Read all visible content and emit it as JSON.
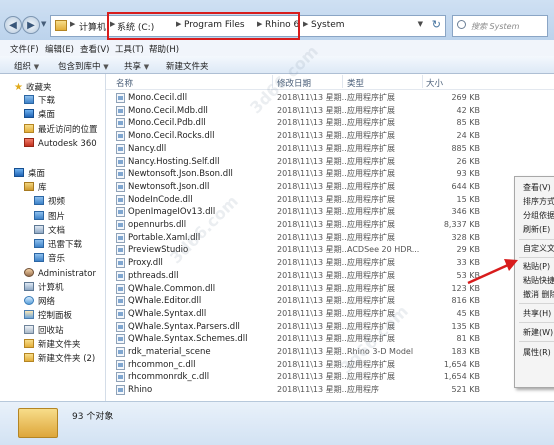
{
  "address": {
    "crumbs": [
      "计算机",
      "系统 (C:)",
      "Program Files",
      "Rhino 6",
      "System"
    ],
    "search_placeholder": "搜索 System"
  },
  "menu": [
    "文件(F)",
    "编辑(E)",
    "查看(V)",
    "工具(T)",
    "帮助(H)"
  ],
  "toolbar": {
    "organize": "组织",
    "include": "包含到库中",
    "share": "共享",
    "new_folder": "新建文件夹"
  },
  "sidebar": {
    "favorites": "收藏夹",
    "downloads": "下载",
    "desktop_fav": "桌面",
    "recent": "最近访问的位置",
    "autodesk": "Autodesk 360",
    "desktop": "桌面",
    "libraries": "库",
    "videos": "视频",
    "pictures": "图片",
    "documents": "文档",
    "thunder": "迅雷下载",
    "music": "音乐",
    "admin": "Administrator",
    "computer": "计算机",
    "network": "网络",
    "control": "控制面板",
    "recycle": "回收站",
    "newfolder": "新建文件夹",
    "newfolder2": "新建文件夹 (2)"
  },
  "headers": {
    "name": "名称",
    "date": "修改日期",
    "type": "类型",
    "size": "大小"
  },
  "files": [
    {
      "name": "Mono.Cecil.dll",
      "date": "2018\\11\\13 星期...",
      "type": "应用程序扩展",
      "size": "269 KB"
    },
    {
      "name": "Mono.Cecil.Mdb.dll",
      "date": "2018\\11\\13 星期...",
      "type": "应用程序扩展",
      "size": "42 KB"
    },
    {
      "name": "Mono.Cecil.Pdb.dll",
      "date": "2018\\11\\13 星期...",
      "type": "应用程序扩展",
      "size": "85 KB"
    },
    {
      "name": "Mono.Cecil.Rocks.dll",
      "date": "2018\\11\\13 星期...",
      "type": "应用程序扩展",
      "size": "24 KB"
    },
    {
      "name": "Nancy.dll",
      "date": "2018\\11\\13 星期...",
      "type": "应用程序扩展",
      "size": "885 KB"
    },
    {
      "name": "Nancy.Hosting.Self.dll",
      "date": "2018\\11\\13 星期...",
      "type": "应用程序扩展",
      "size": "26 KB"
    },
    {
      "name": "Newtonsoft.Json.Bson.dll",
      "date": "2018\\11\\13 星期...",
      "type": "应用程序扩展",
      "size": "93 KB"
    },
    {
      "name": "Newtonsoft.Json.dll",
      "date": "2018\\11\\13 星期...",
      "type": "应用程序扩展",
      "size": "644 KB"
    },
    {
      "name": "NodeInCode.dll",
      "date": "2018\\11\\13 星期...",
      "type": "应用程序扩展",
      "size": "15 KB"
    },
    {
      "name": "OpenImageIOv13.dll",
      "date": "2018\\11\\13 星期...",
      "type": "应用程序扩展",
      "size": "346 KB"
    },
    {
      "name": "opennurbs.dll",
      "date": "2018\\11\\13 星期...",
      "type": "应用程序扩展",
      "size": "8,337 KB"
    },
    {
      "name": "Portable.Xaml.dll",
      "date": "2018\\11\\13 星期...",
      "type": "应用程序扩展",
      "size": "328 KB"
    },
    {
      "name": "PreviewStudio",
      "date": "2018\\11\\13 星期...",
      "type": "ACDSee 20 HDR...",
      "size": "29 KB"
    },
    {
      "name": "Proxy.dll",
      "date": "2018\\11\\13 星期...",
      "type": "应用程序扩展",
      "size": "33 KB"
    },
    {
      "name": "pthreads.dll",
      "date": "2018\\11\\13 星期...",
      "type": "应用程序扩展",
      "size": "53 KB"
    },
    {
      "name": "QWhale.Common.dll",
      "date": "2018\\11\\13 星期...",
      "type": "应用程序扩展",
      "size": "123 KB"
    },
    {
      "name": "QWhale.Editor.dll",
      "date": "2018\\11\\13 星期...",
      "type": "应用程序扩展",
      "size": "816 KB"
    },
    {
      "name": "QWhale.Syntax.dll",
      "date": "2018\\11\\13 星期...",
      "type": "应用程序扩展",
      "size": "45 KB"
    },
    {
      "name": "QWhale.Syntax.Parsers.dll",
      "date": "2018\\11\\13 星期...",
      "type": "应用程序扩展",
      "size": "135 KB"
    },
    {
      "name": "QWhale.Syntax.Schemes.dll",
      "date": "2018\\11\\13 星期...",
      "type": "应用程序扩展",
      "size": "81 KB"
    },
    {
      "name": "rdk_material_scene",
      "date": "2018\\11\\13 星期...",
      "type": "Rhino 3-D Model",
      "size": "183 KB"
    },
    {
      "name": "rhcommon_c.dll",
      "date": "2018\\11\\13 星期...",
      "type": "应用程序扩展",
      "size": "1,654 KB"
    },
    {
      "name": "rhcommonrdk_c.dll",
      "date": "2018\\11\\13 星期...",
      "type": "应用程序扩展",
      "size": "1,654 KB"
    },
    {
      "name": "Rhino",
      "date": "2018\\11\\13 星期...",
      "type": "应用程序",
      "size": "521 KB"
    }
  ],
  "context_menu": [
    "查看(V)",
    "排序方式",
    "分组依据",
    "刷新(E)",
    "自定义文",
    "粘贴(P)",
    "粘贴快捷",
    "撤消 删除",
    "共享(H)",
    "新建(W)",
    "属性(R)"
  ],
  "status": "93 个对象",
  "accent_color": "#d81c1c"
}
